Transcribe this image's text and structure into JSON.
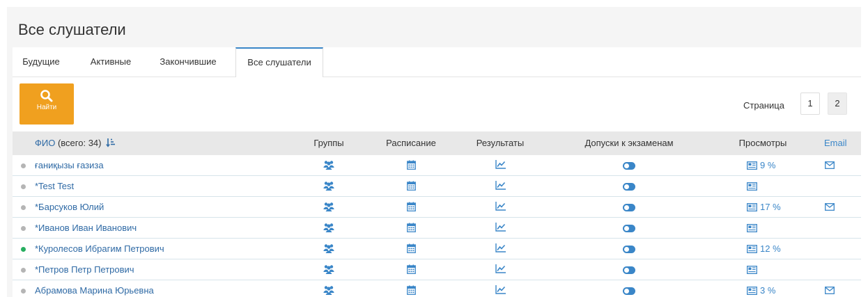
{
  "page": {
    "title": "Все слушатели"
  },
  "tabs": [
    {
      "label": "Будущие"
    },
    {
      "label": "Активные"
    },
    {
      "label": "Закончившие"
    },
    {
      "label": "Все слушатели",
      "active": true
    }
  ],
  "toolbar": {
    "find_label": "Найти",
    "find_icon": "search-icon"
  },
  "pager": {
    "label": "Страница",
    "pages": [
      "1",
      "2"
    ],
    "current": "2"
  },
  "table": {
    "headers": {
      "fio": "ФИО",
      "fio_count": "(всего: 34)",
      "groups": "Группы",
      "schedule": "Расписание",
      "results": "Результаты",
      "exams": "Допуски к экзаменам",
      "views": "Просмотры",
      "email": "Email"
    },
    "rows": [
      {
        "name": "ғаниқызы ғазиза",
        "online": false,
        "views": "9 %",
        "email": true
      },
      {
        "name": "*Test Test",
        "online": false,
        "views": "",
        "email": false
      },
      {
        "name": "*Барсуков Юлий",
        "online": false,
        "views": "17 %",
        "email": true
      },
      {
        "name": "*Иванов Иван Иванович",
        "online": false,
        "views": "",
        "email": false
      },
      {
        "name": "*Куролесов Ибрагим Петрович",
        "online": true,
        "views": "12 %",
        "email": false
      },
      {
        "name": "*Петров Петр Петрович",
        "online": false,
        "views": "",
        "email": false
      },
      {
        "name": "Абрамова Марина Юрьевна",
        "online": false,
        "views": "3 %",
        "email": true
      }
    ]
  },
  "colors": {
    "accent": "#f0a01f",
    "link": "#2f6aa5",
    "icon": "#3a86c8",
    "online": "#27ae60",
    "offline": "#b5b5b5"
  }
}
